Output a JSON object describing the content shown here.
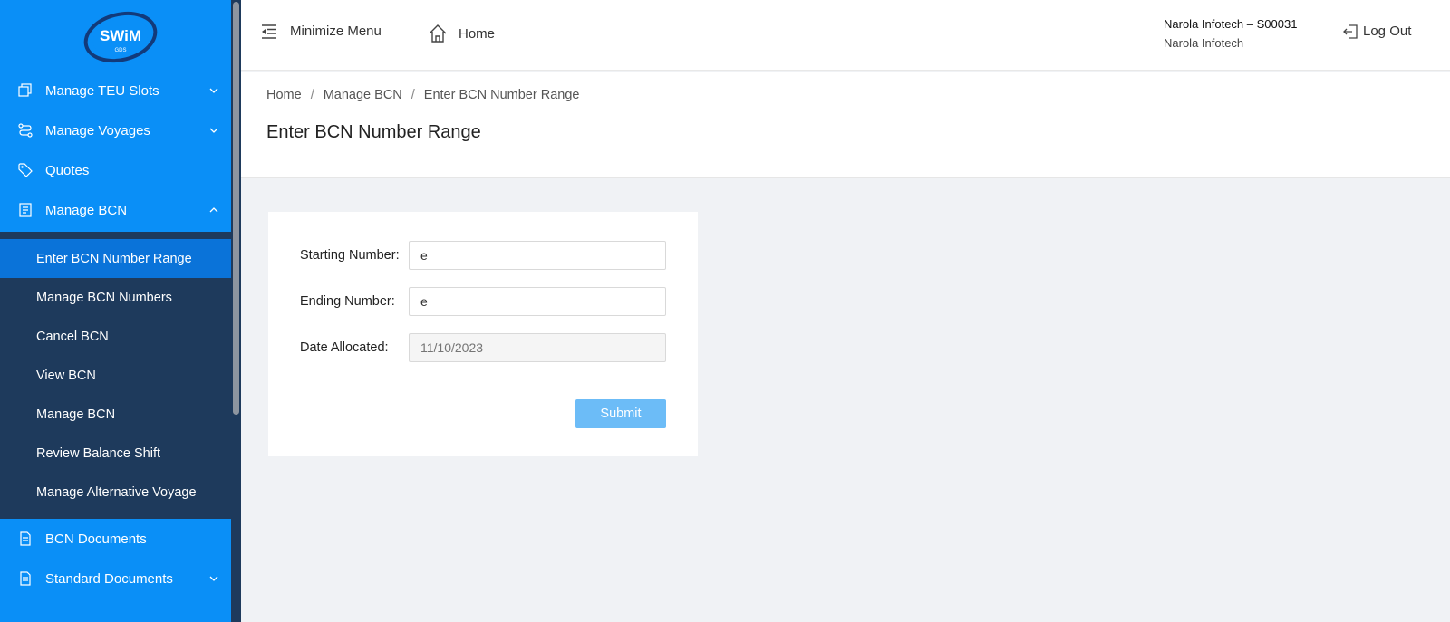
{
  "app": {
    "logo_text": "SWiM",
    "logo_sub": "GDS"
  },
  "sidebar": {
    "items": [
      {
        "label": "Manage TEU Slots",
        "icon": "copy-icon",
        "expandable": true
      },
      {
        "label": "Manage Voyages",
        "icon": "route-icon",
        "expandable": true
      },
      {
        "label": "Quotes",
        "icon": "tag-icon",
        "expandable": false
      },
      {
        "label": "Manage BCN",
        "icon": "file-text-icon",
        "expandable": true,
        "expanded": true
      },
      {
        "label": "BCN Documents",
        "icon": "document-icon",
        "expandable": false
      },
      {
        "label": "Standard Documents",
        "icon": "document-icon",
        "expandable": true
      }
    ],
    "submenu": [
      {
        "label": "Enter BCN Number Range",
        "active": true
      },
      {
        "label": "Manage BCN Numbers"
      },
      {
        "label": "Cancel BCN"
      },
      {
        "label": "View BCN"
      },
      {
        "label": "Manage BCN"
      },
      {
        "label": "Review Balance Shift"
      },
      {
        "label": "Manage Alternative Voyage"
      }
    ]
  },
  "header": {
    "minimize_label": "Minimize Menu",
    "home_label": "Home",
    "user_name": "Narola Infotech – S00031",
    "user_org": "Narola Infotech",
    "logout_label": "Log Out"
  },
  "breadcrumb": [
    "Home",
    "Manage BCN",
    "Enter BCN Number Range"
  ],
  "page_title": "Enter BCN Number Range",
  "form": {
    "starting_label": "Starting Number:",
    "starting_value": "e",
    "ending_label": "Ending Number:",
    "ending_value": "e",
    "date_label": "Date Allocated:",
    "date_placeholder": "11/10/2023",
    "submit_label": "Submit"
  },
  "colors": {
    "sidebar": "#0a8ff7",
    "submenu": "#1e3a5c",
    "submenu_active": "#0a73d9",
    "submit": "#6cbcf7"
  }
}
